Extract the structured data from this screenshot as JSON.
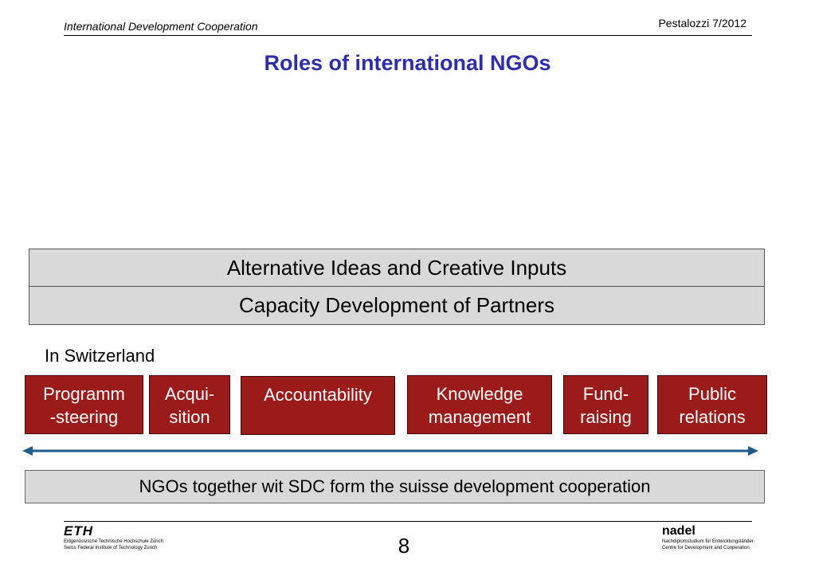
{
  "header": {
    "left_text": "International Development Cooperation",
    "right_text": "Pestalozzi 7/2012"
  },
  "title": "Roles of international NGOs",
  "international_roles": [
    "Alternative Ideas and Creative Inputs",
    "Capacity Development of Partners"
  ],
  "switzerland": {
    "heading": "In Switzerland",
    "roles": [
      {
        "line1": "Programm",
        "line2": "-steering"
      },
      {
        "line1": "Acqui-",
        "line2": "sition"
      },
      {
        "line1": "Accountability",
        "line2": ""
      },
      {
        "line1": "Knowledge",
        "line2": "management"
      },
      {
        "line1": "Fund-",
        "line2": "raising"
      },
      {
        "line1": "Public",
        "line2": "relations"
      }
    ]
  },
  "summary": "NGOs together wit SDC form the suisse development cooperation",
  "footer": {
    "eth": {
      "mark": "ETH",
      "line1": "Eidgenössische Technische Hochschule Zürich",
      "line2": "Swiss Federal Institute of Technology Zurich"
    },
    "page_number": "8",
    "nadel": {
      "mark": "nadel",
      "line1": "Nachdiplomstudium für Entwicklungsländer",
      "line2": "Centre for Development and Cooperation"
    }
  },
  "colors": {
    "title": "#2e2ea8",
    "role_box": "#9b1b1b",
    "gray_box": "#d9d9d9",
    "arrow": "#1f5c8c"
  }
}
